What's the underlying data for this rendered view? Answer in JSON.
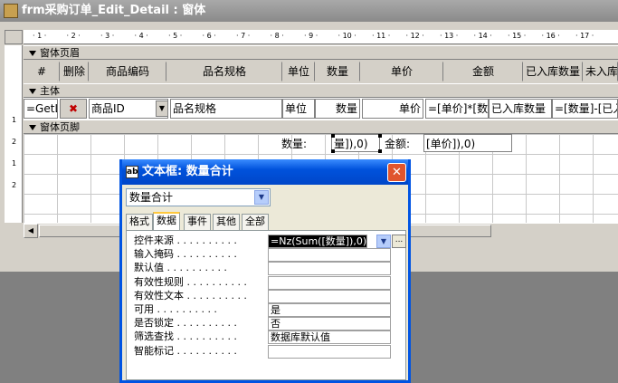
{
  "window": {
    "title": "frm采购订单_Edit_Detail : 窗体"
  },
  "ruler": {
    "marks": [
      "1",
      "2",
      "3",
      "4",
      "5",
      "6",
      "7",
      "8",
      "9",
      "10",
      "11",
      "12",
      "13",
      "14",
      "15",
      "16",
      "17"
    ],
    "vmarks": [
      "1",
      "2",
      "1",
      "2"
    ]
  },
  "sections": {
    "header": "窗体页眉",
    "detail": "主体",
    "footer": "窗体页脚"
  },
  "header_labels": [
    "#",
    "删除",
    "商品编码",
    "品名规格",
    "单位",
    "数量",
    "单价",
    "金额",
    "已入库数量",
    "未入库数量"
  ],
  "detail_controls": {
    "getl": "=GetL",
    "goods_id": "商品ID",
    "spec": "品名规格",
    "unit": "单位",
    "qty": "数量",
    "price": "单价",
    "amount": "=[单价]*[数量]",
    "in_qty": "已入库数量",
    "not_in": "=[数量]-[已入库数量]"
  },
  "footer_controls": {
    "qty_label": "数量:",
    "qty_expr": "量]),0)",
    "amount_label": "金额:",
    "amount_expr": "[单价]),0)"
  },
  "property_sheet": {
    "title": "文本框: 数量合计",
    "selected_object": "数量合计",
    "tabs": [
      "格式",
      "数据",
      "事件",
      "其他",
      "全部"
    ],
    "active_tab": "数据",
    "rows": [
      {
        "name": "控件来源",
        "value": "=Nz(Sum([数量]),0)"
      },
      {
        "name": "输入掩码",
        "value": ""
      },
      {
        "name": "默认值",
        "value": ""
      },
      {
        "name": "有效性规则",
        "value": ""
      },
      {
        "name": "有效性文本",
        "value": ""
      },
      {
        "name": "可用",
        "value": "是"
      },
      {
        "name": "是否锁定",
        "value": "否"
      },
      {
        "name": "筛选查找",
        "value": "数据库默认值"
      },
      {
        "name": "智能标记",
        "value": ""
      }
    ],
    "builder_label": "..."
  }
}
